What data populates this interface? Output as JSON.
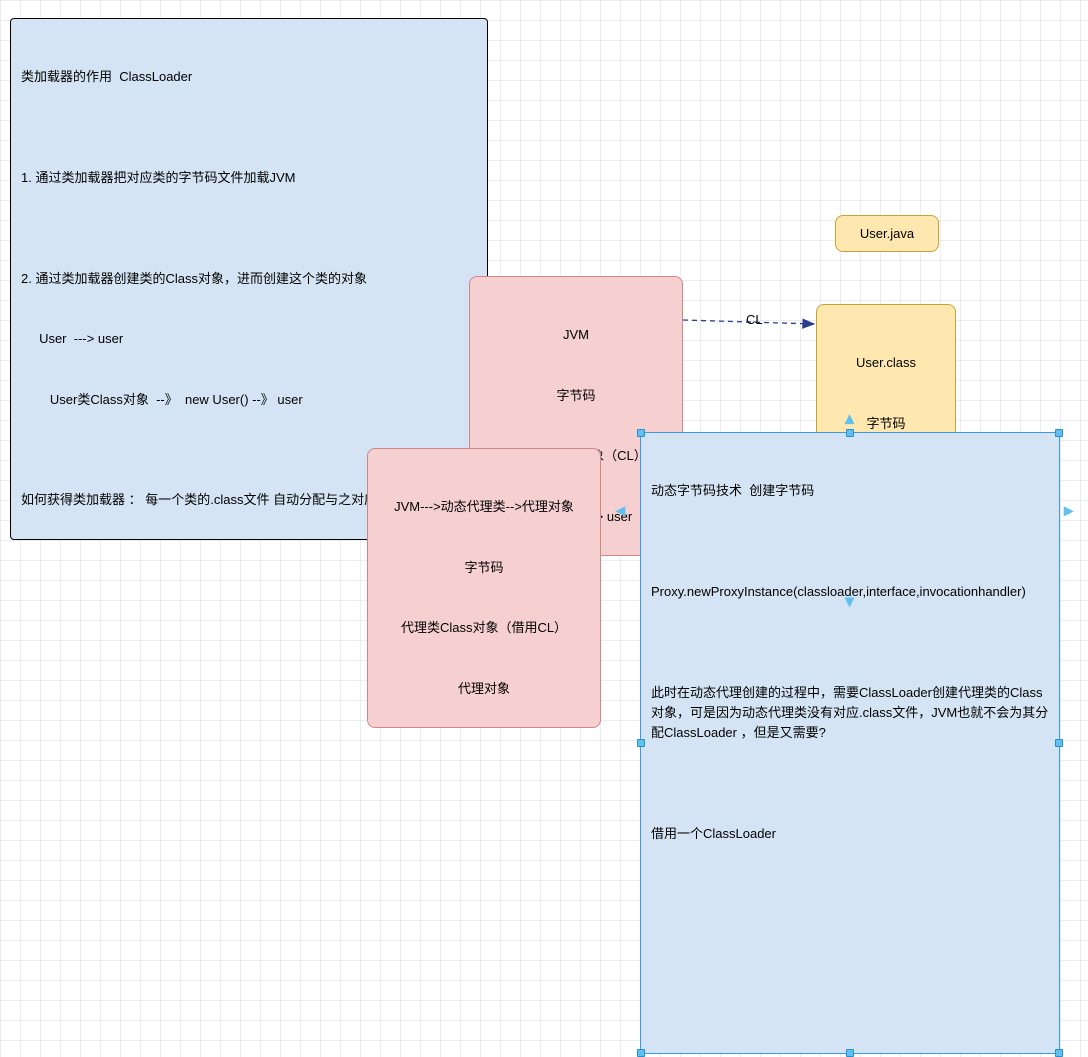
{
  "top_note": {
    "title": "类加载器的作用  ClassLoader",
    "blank1": "",
    "p1": "1. 通过类加载器把对应类的字节码文件加载JVM",
    "blank2": "",
    "p2": "2. 通过类加载器创建类的Class对象，进而创建这个类的对象",
    "p2a": "     User  ---> user",
    "p2b": "        User类Class对象  --》  new User() --》 user",
    "blank3": "",
    "p3": "如何获得类加载器 ： 每一个类的.class文件 自动分配与之对应的ClassLoader"
  },
  "jvm_box": {
    "l1": "JVM",
    "l2": "字节码",
    "l3": "User类Class对象（CL）",
    "l4": "new User() --> user"
  },
  "yellow1": {
    "label": "User.java"
  },
  "yellow2": {
    "l1": "User.class",
    "l2": "字节码"
  },
  "arrow_label": "CL",
  "pink2": {
    "l1": "JVM--->动态代理类-->代理对象",
    "l2": "字节码",
    "l3": "代理类Class对象（借用CL）",
    "l4": "代理对象"
  },
  "right_note": {
    "l1": "动态字节码技术  创建字节码",
    "blank1": "",
    "l2": "Proxy.newProxyInstance(classloader,interface,invocationhandler)",
    "blank2": "",
    "l3": "此时在动态代理创建的过程中，需要ClassLoader创建代理类的Class对象，可是因为动态代理类没有对应.class文件，JVM也就不会为其分配ClassLoader ，但是又需要?",
    "blank3": "",
    "l4": "借用一个ClassLoader"
  }
}
